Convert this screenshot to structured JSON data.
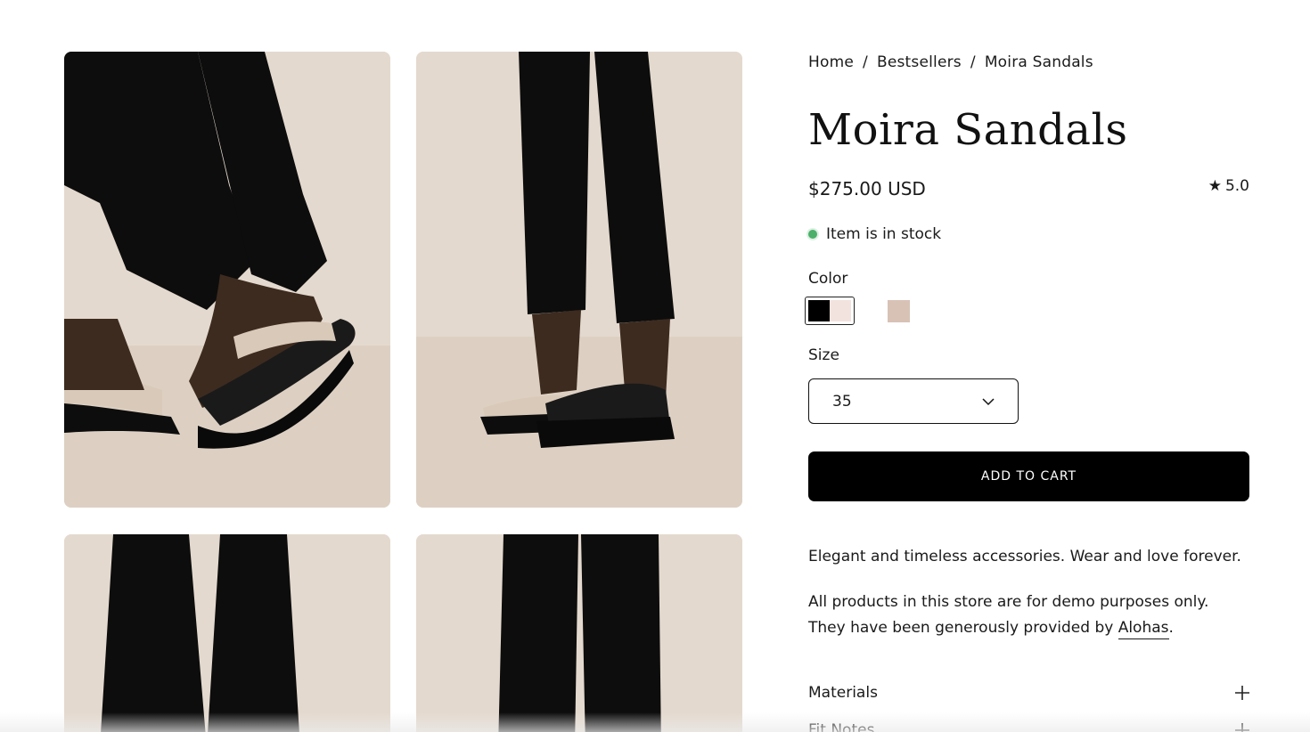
{
  "breadcrumb": {
    "items": [
      "Home",
      "Bestsellers",
      "Moira Sandals"
    ],
    "separator": "/"
  },
  "product": {
    "title": "Moira Sandals",
    "price": "$275.00 USD",
    "rating": "5.0",
    "stock_text": "Item is in stock",
    "stock_color": "#4caf6a"
  },
  "options": {
    "color_label": "Color",
    "swatches": [
      {
        "name": "black-cream",
        "colors": [
          "#000000",
          "#f2e3df"
        ],
        "selected": true
      },
      {
        "name": "sand",
        "colors": [
          "#d8c2b6"
        ],
        "selected": false
      }
    ],
    "size_label": "Size",
    "size_value": "35"
  },
  "actions": {
    "add_to_cart": "ADD TO CART"
  },
  "description": {
    "line1": "Elegant and timeless accessories. Wear and love forever.",
    "line2_prefix": "All products in this store are for demo purposes only. They have been generously provided by ",
    "line2_link": "Alohas",
    "line2_suffix": "."
  },
  "accordions": [
    {
      "label": "Materials"
    },
    {
      "label": "Fit Notes"
    }
  ],
  "icons": {
    "rating": "star-icon",
    "size_select": "chevron-down-icon",
    "accordion": "plus-icon"
  }
}
